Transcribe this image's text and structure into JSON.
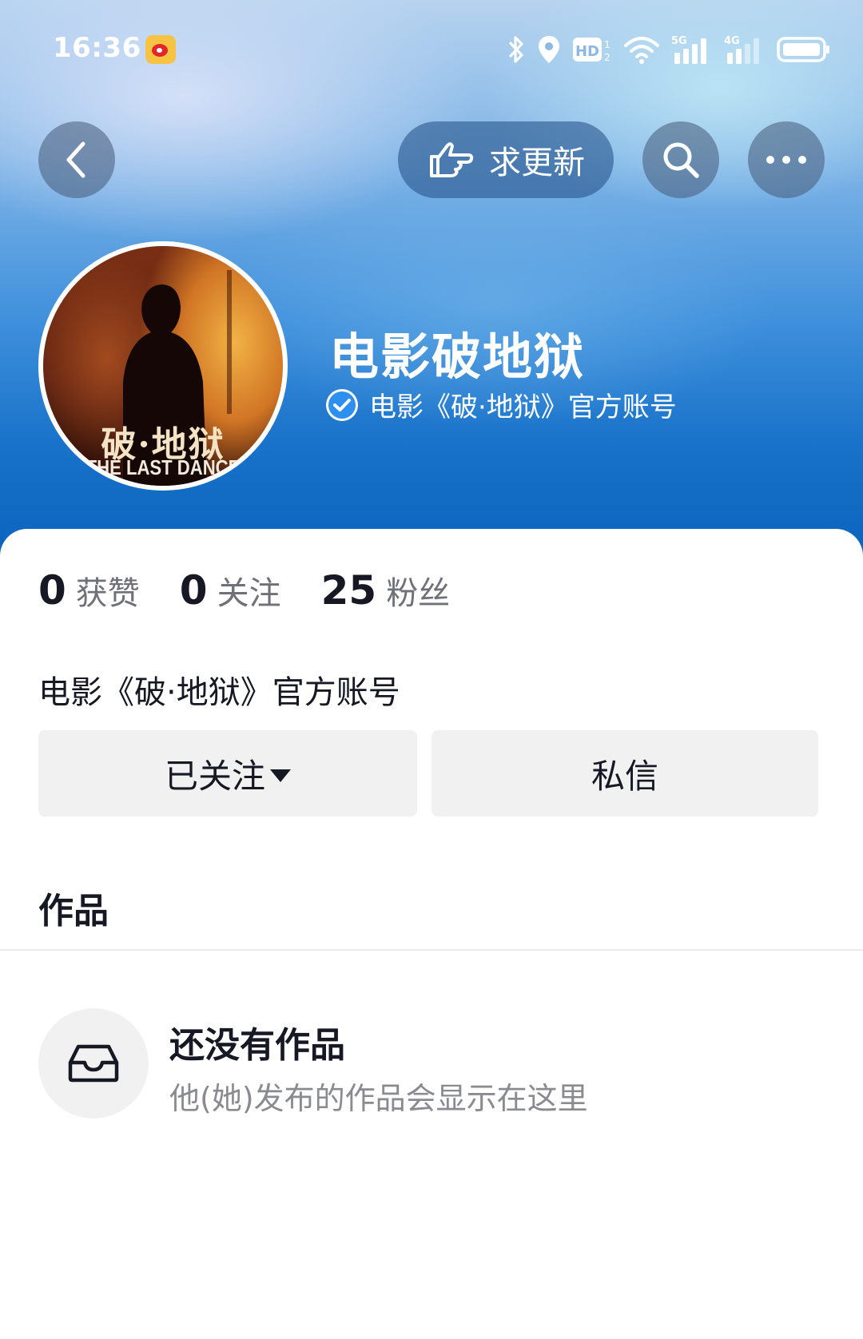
{
  "status_bar": {
    "time": "16:36",
    "network_5g": "5G",
    "network_4g": "4G",
    "hd_label": "HD"
  },
  "nav": {
    "update_label": "求更新"
  },
  "profile": {
    "name": "电影破地狱",
    "verified_text": "电影《破·地狱》官方账号",
    "avatar_title": "破·地狱",
    "avatar_subtitle": "THE LAST DANCE"
  },
  "stats": [
    {
      "value": "0",
      "label": "获赞"
    },
    {
      "value": "0",
      "label": "关注"
    },
    {
      "value": "25",
      "label": "粉丝"
    }
  ],
  "bio": "电影《破·地狱》官方账号",
  "actions": {
    "follow_label": "已关注",
    "message_label": "私信"
  },
  "works": {
    "title": "作品",
    "empty_title": "还没有作品",
    "empty_desc": "他(她)发布的作品会显示在这里"
  },
  "colors": {
    "accent_verify": "#2d8ff0",
    "text_primary": "#161823",
    "text_secondary": "#6f7078",
    "button_bg": "#f1f1f2"
  }
}
